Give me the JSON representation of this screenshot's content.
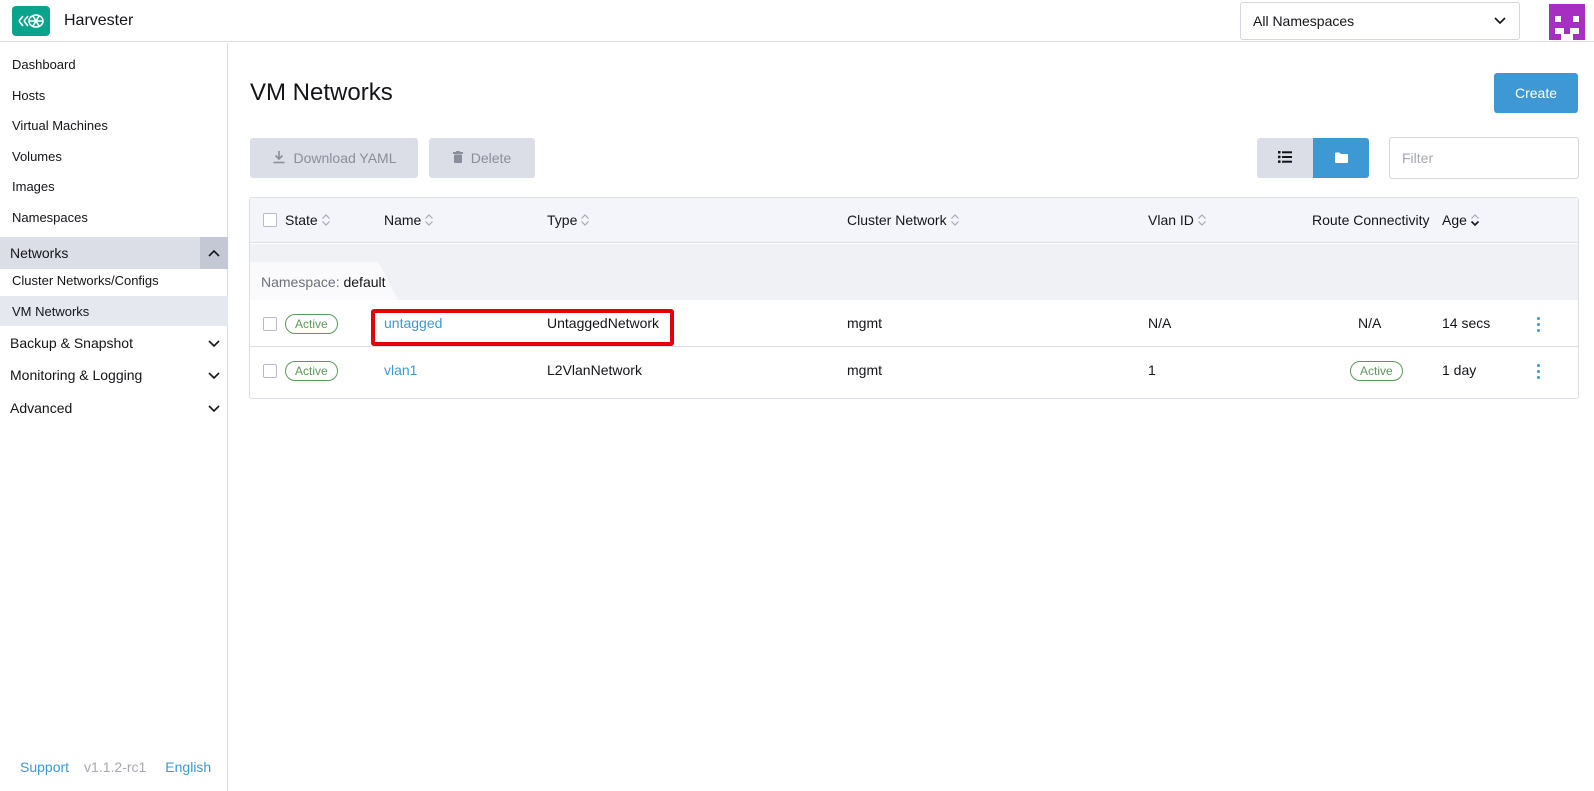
{
  "app": {
    "title": "Harvester",
    "brand_color": "#0aa38c",
    "accent_color": "#3d98d3"
  },
  "header": {
    "namespace_select": "All Namespaces",
    "avatar_icon": "user-avatar-icon"
  },
  "sidebar": {
    "items": [
      {
        "label": "Dashboard"
      },
      {
        "label": "Hosts"
      },
      {
        "label": "Virtual Machines"
      },
      {
        "label": "Volumes"
      },
      {
        "label": "Images"
      },
      {
        "label": "Namespaces"
      }
    ],
    "networks_group": {
      "label": "Networks",
      "children": [
        {
          "label": "Cluster Networks/Configs"
        },
        {
          "label": "VM Networks"
        }
      ]
    },
    "groups": [
      {
        "label": "Backup & Snapshot"
      },
      {
        "label": "Monitoring & Logging"
      },
      {
        "label": "Advanced"
      }
    ],
    "footer": {
      "support": "Support",
      "version": "v1.1.2-rc1",
      "language": "English"
    }
  },
  "main": {
    "title": "VM Networks",
    "create_label": "Create",
    "download_yaml_label": "Download YAML",
    "delete_label": "Delete",
    "filter_placeholder": "Filter"
  },
  "table": {
    "columns": {
      "state": "State",
      "name": "Name",
      "type": "Type",
      "cluster_network": "Cluster Network",
      "vlan_id": "Vlan ID",
      "route_connectivity": "Route Connectivity",
      "age": "Age"
    },
    "group": {
      "prefix": "Namespace:",
      "value": "default"
    },
    "rows": [
      {
        "state": "Active",
        "name": "untagged",
        "type": "UntaggedNetwork",
        "cluster_network": "mgmt",
        "vlan_id": "N/A",
        "route_connectivity": "N/A",
        "age": "14 secs"
      },
      {
        "state": "Active",
        "name": "vlan1",
        "type": "L2VlanNetwork",
        "cluster_network": "mgmt",
        "vlan_id": "1",
        "route_connectivity": "Active",
        "age": "1 day"
      }
    ]
  }
}
